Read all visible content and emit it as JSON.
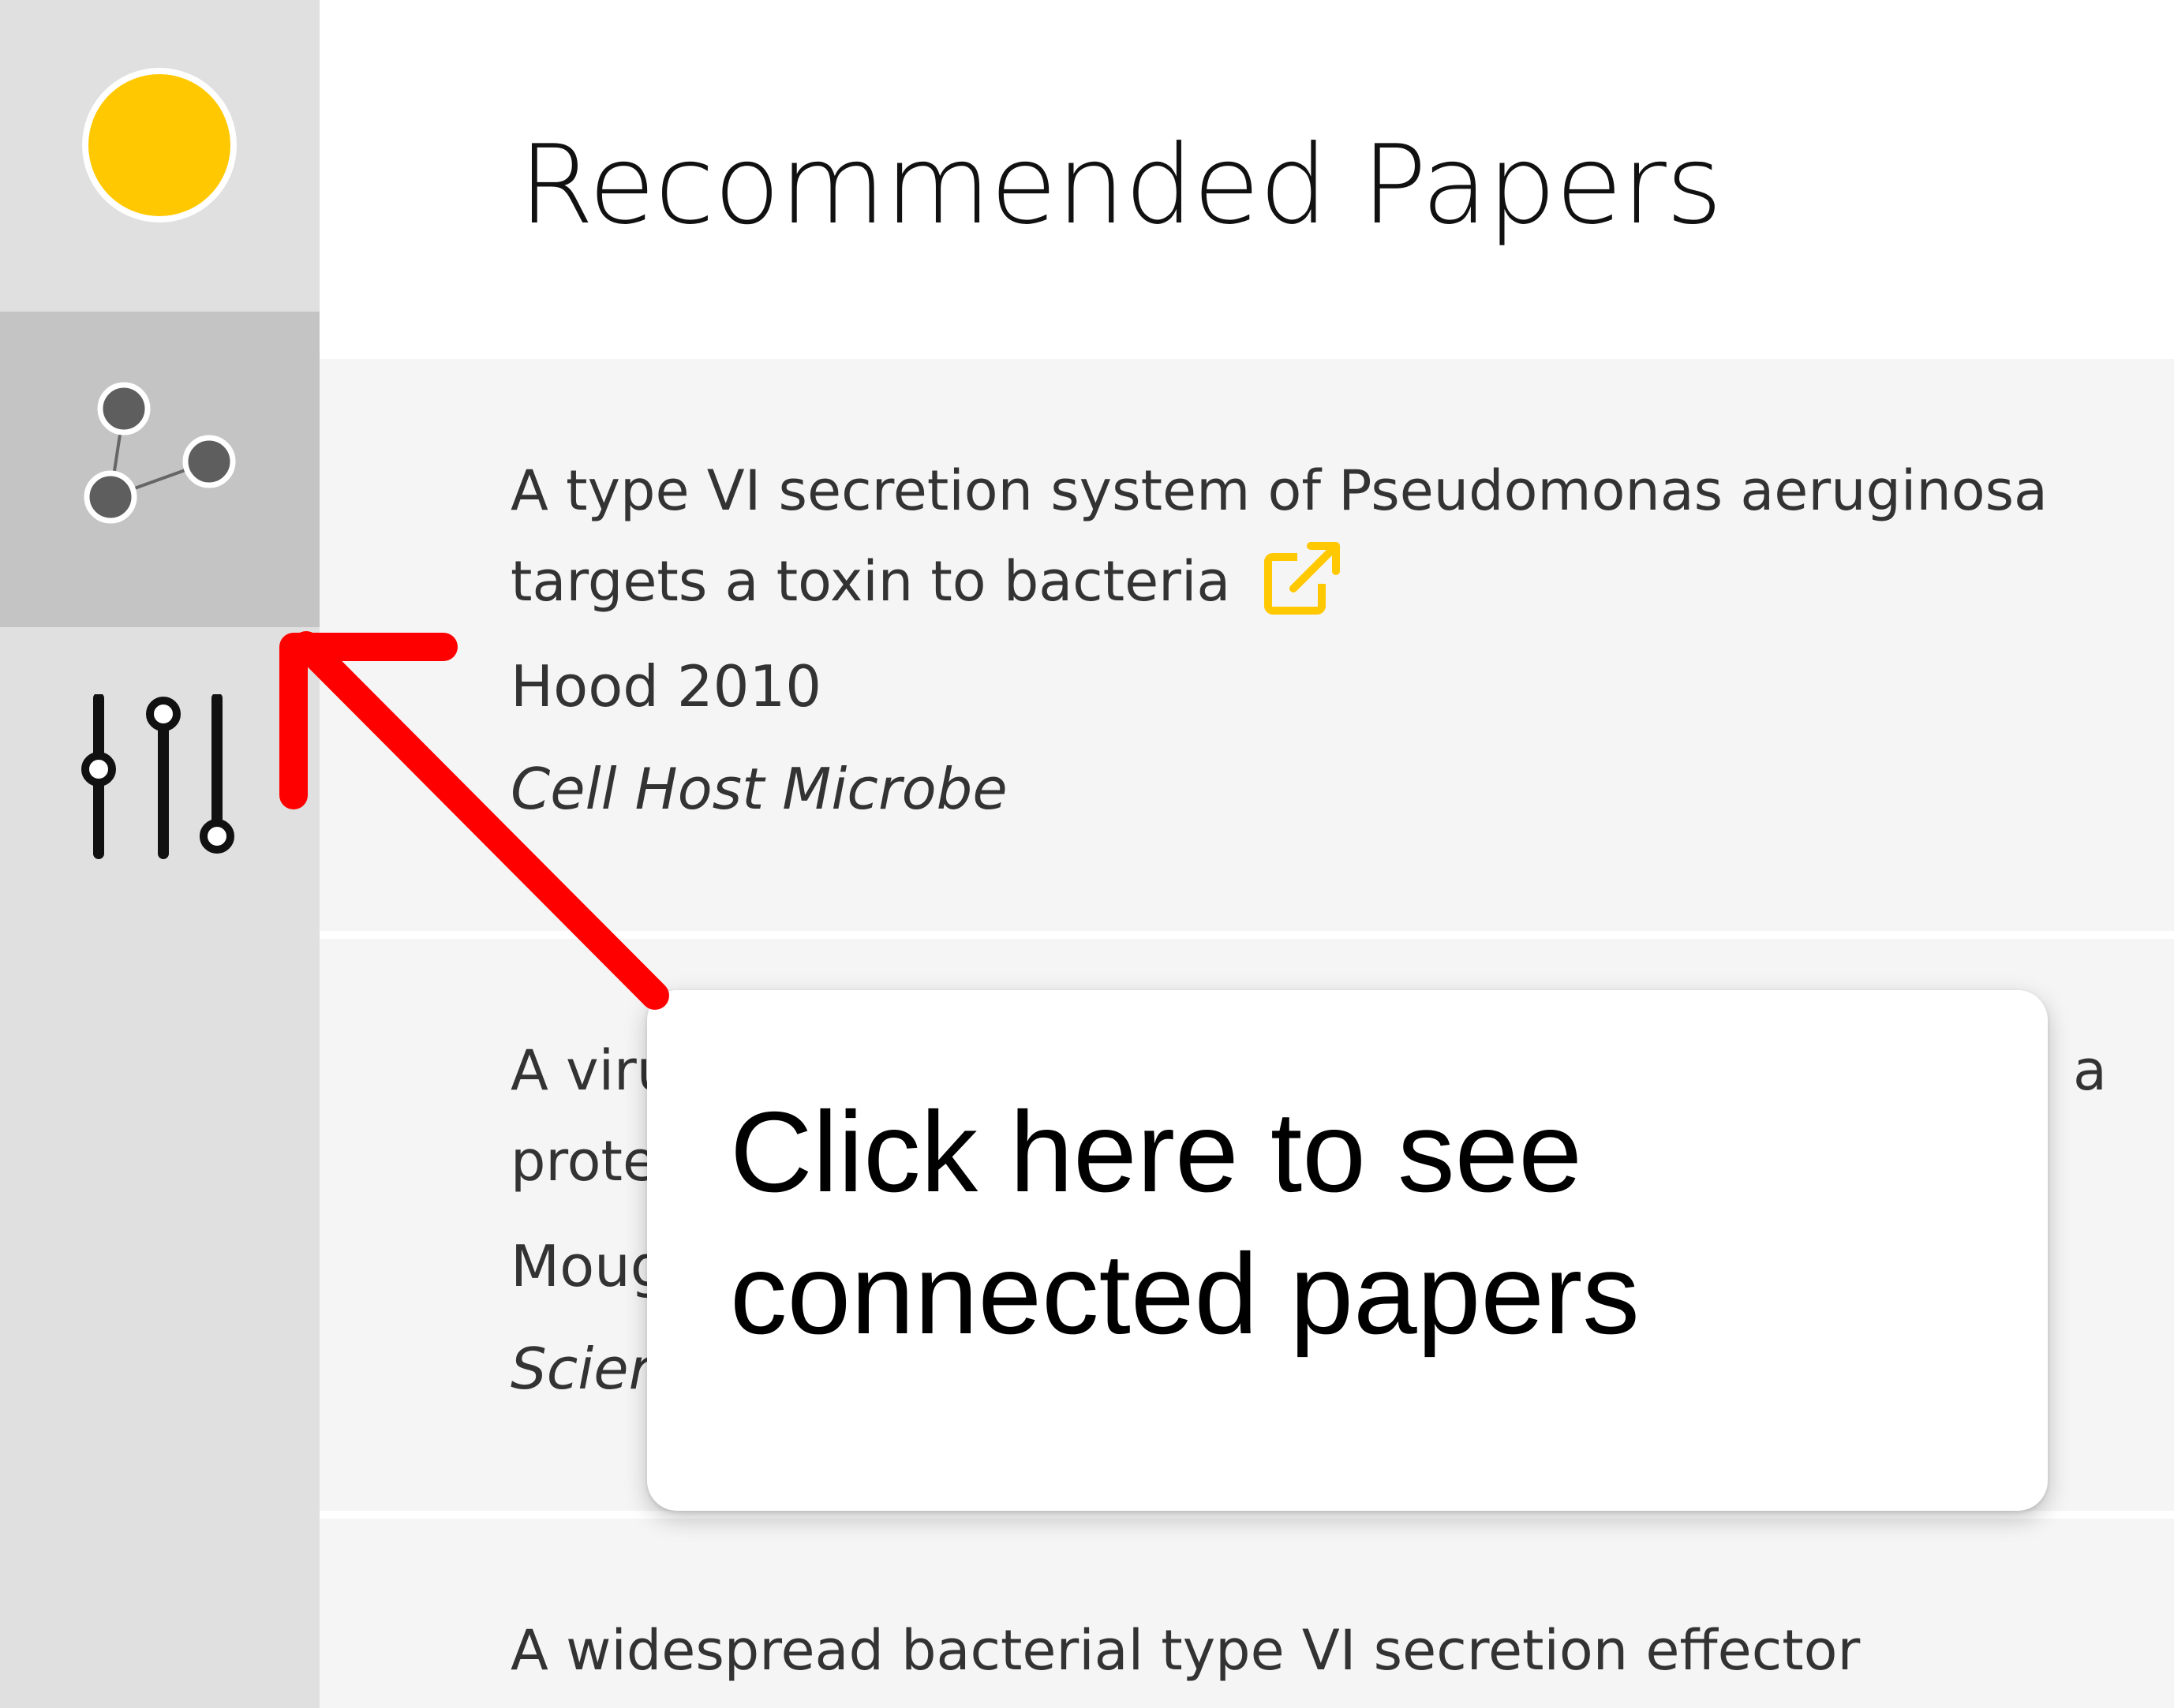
{
  "colors": {
    "brand_yellow": "#ffc800",
    "sidebar_bg": "#e0e0e0",
    "sidebar_active_bg": "#c4c4c4",
    "card_bg": "#f5f5f5",
    "arrow_red": "#ff0000"
  },
  "sidebar": {
    "logo_icon": "yellow-circle-logo",
    "items": [
      {
        "icon": "graph-nodes-icon",
        "active": true
      },
      {
        "icon": "sliders-filter-icon",
        "active": false
      }
    ]
  },
  "main": {
    "title": "Recommended Papers",
    "papers": [
      {
        "title": "A type VI secretion system of Pseudomonas aeruginosa targets a toxin to bacteria",
        "author_year": "Hood 2010",
        "journal": "Cell Host Microbe",
        "link_icon": "external-link-icon"
      },
      {
        "title": "A viru",
        "title_tail": "a",
        "title_line2": "prote",
        "author_year": "Moug",
        "journal": "Scier"
      },
      {
        "title": "A widespread bacterial type VI secretion effector",
        "link_icon": "external-link-icon"
      }
    ]
  },
  "tooltip": {
    "line1": "Click here to see",
    "line2": "connected papers"
  }
}
